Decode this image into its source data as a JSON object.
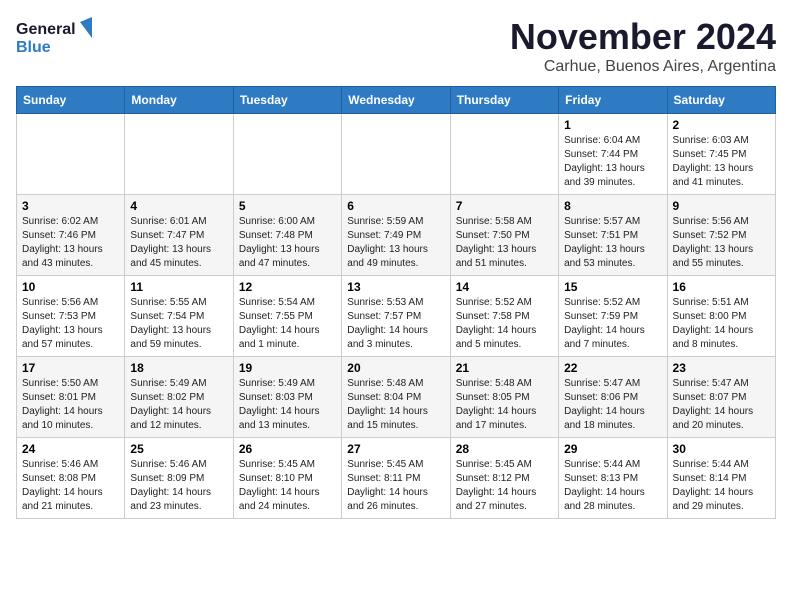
{
  "header": {
    "logo_line1": "General",
    "logo_line2": "Blue",
    "title": "November 2024",
    "subtitle": "Carhue, Buenos Aires, Argentina"
  },
  "weekdays": [
    "Sunday",
    "Monday",
    "Tuesday",
    "Wednesday",
    "Thursday",
    "Friday",
    "Saturday"
  ],
  "weeks": [
    [
      {
        "day": "",
        "info": ""
      },
      {
        "day": "",
        "info": ""
      },
      {
        "day": "",
        "info": ""
      },
      {
        "day": "",
        "info": ""
      },
      {
        "day": "",
        "info": ""
      },
      {
        "day": "1",
        "info": "Sunrise: 6:04 AM\nSunset: 7:44 PM\nDaylight: 13 hours\nand 39 minutes."
      },
      {
        "day": "2",
        "info": "Sunrise: 6:03 AM\nSunset: 7:45 PM\nDaylight: 13 hours\nand 41 minutes."
      }
    ],
    [
      {
        "day": "3",
        "info": "Sunrise: 6:02 AM\nSunset: 7:46 PM\nDaylight: 13 hours\nand 43 minutes."
      },
      {
        "day": "4",
        "info": "Sunrise: 6:01 AM\nSunset: 7:47 PM\nDaylight: 13 hours\nand 45 minutes."
      },
      {
        "day": "5",
        "info": "Sunrise: 6:00 AM\nSunset: 7:48 PM\nDaylight: 13 hours\nand 47 minutes."
      },
      {
        "day": "6",
        "info": "Sunrise: 5:59 AM\nSunset: 7:49 PM\nDaylight: 13 hours\nand 49 minutes."
      },
      {
        "day": "7",
        "info": "Sunrise: 5:58 AM\nSunset: 7:50 PM\nDaylight: 13 hours\nand 51 minutes."
      },
      {
        "day": "8",
        "info": "Sunrise: 5:57 AM\nSunset: 7:51 PM\nDaylight: 13 hours\nand 53 minutes."
      },
      {
        "day": "9",
        "info": "Sunrise: 5:56 AM\nSunset: 7:52 PM\nDaylight: 13 hours\nand 55 minutes."
      }
    ],
    [
      {
        "day": "10",
        "info": "Sunrise: 5:56 AM\nSunset: 7:53 PM\nDaylight: 13 hours\nand 57 minutes."
      },
      {
        "day": "11",
        "info": "Sunrise: 5:55 AM\nSunset: 7:54 PM\nDaylight: 13 hours\nand 59 minutes."
      },
      {
        "day": "12",
        "info": "Sunrise: 5:54 AM\nSunset: 7:55 PM\nDaylight: 14 hours\nand 1 minute."
      },
      {
        "day": "13",
        "info": "Sunrise: 5:53 AM\nSunset: 7:57 PM\nDaylight: 14 hours\nand 3 minutes."
      },
      {
        "day": "14",
        "info": "Sunrise: 5:52 AM\nSunset: 7:58 PM\nDaylight: 14 hours\nand 5 minutes."
      },
      {
        "day": "15",
        "info": "Sunrise: 5:52 AM\nSunset: 7:59 PM\nDaylight: 14 hours\nand 7 minutes."
      },
      {
        "day": "16",
        "info": "Sunrise: 5:51 AM\nSunset: 8:00 PM\nDaylight: 14 hours\nand 8 minutes."
      }
    ],
    [
      {
        "day": "17",
        "info": "Sunrise: 5:50 AM\nSunset: 8:01 PM\nDaylight: 14 hours\nand 10 minutes."
      },
      {
        "day": "18",
        "info": "Sunrise: 5:49 AM\nSunset: 8:02 PM\nDaylight: 14 hours\nand 12 minutes."
      },
      {
        "day": "19",
        "info": "Sunrise: 5:49 AM\nSunset: 8:03 PM\nDaylight: 14 hours\nand 13 minutes."
      },
      {
        "day": "20",
        "info": "Sunrise: 5:48 AM\nSunset: 8:04 PM\nDaylight: 14 hours\nand 15 minutes."
      },
      {
        "day": "21",
        "info": "Sunrise: 5:48 AM\nSunset: 8:05 PM\nDaylight: 14 hours\nand 17 minutes."
      },
      {
        "day": "22",
        "info": "Sunrise: 5:47 AM\nSunset: 8:06 PM\nDaylight: 14 hours\nand 18 minutes."
      },
      {
        "day": "23",
        "info": "Sunrise: 5:47 AM\nSunset: 8:07 PM\nDaylight: 14 hours\nand 20 minutes."
      }
    ],
    [
      {
        "day": "24",
        "info": "Sunrise: 5:46 AM\nSunset: 8:08 PM\nDaylight: 14 hours\nand 21 minutes."
      },
      {
        "day": "25",
        "info": "Sunrise: 5:46 AM\nSunset: 8:09 PM\nDaylight: 14 hours\nand 23 minutes."
      },
      {
        "day": "26",
        "info": "Sunrise: 5:45 AM\nSunset: 8:10 PM\nDaylight: 14 hours\nand 24 minutes."
      },
      {
        "day": "27",
        "info": "Sunrise: 5:45 AM\nSunset: 8:11 PM\nDaylight: 14 hours\nand 26 minutes."
      },
      {
        "day": "28",
        "info": "Sunrise: 5:45 AM\nSunset: 8:12 PM\nDaylight: 14 hours\nand 27 minutes."
      },
      {
        "day": "29",
        "info": "Sunrise: 5:44 AM\nSunset: 8:13 PM\nDaylight: 14 hours\nand 28 minutes."
      },
      {
        "day": "30",
        "info": "Sunrise: 5:44 AM\nSunset: 8:14 PM\nDaylight: 14 hours\nand 29 minutes."
      }
    ]
  ]
}
